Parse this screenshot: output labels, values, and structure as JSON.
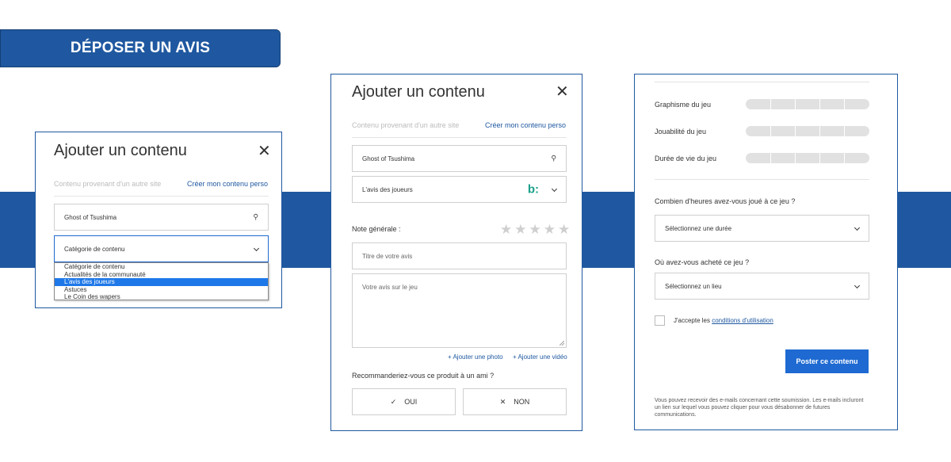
{
  "header": {
    "label": "DÉPOSER UN AVIS"
  },
  "panel1": {
    "title": "Ajouter un contenu",
    "close": "✕",
    "source_text": "Contenu provenant d'un autre site",
    "create_link": "Créer mon contenu perso",
    "search_value": "Ghost of Tsushima",
    "category_value": "Catégorie de contenu",
    "dropdown_options": [
      "Catégorie de contenu",
      "Actualités de la communauté",
      "L'avis des joueurs",
      "Astuces",
      "Le Coin des wapers"
    ],
    "selected_option": "L'avis des joueurs"
  },
  "panel2": {
    "title": "Ajouter un contenu",
    "close": "✕",
    "source_text": "Contenu provenant d'un autre site",
    "create_link": "Créer mon contenu perso",
    "search_value": "Ghost of Tsushima",
    "category_value": "L'avis des joueurs",
    "category_badge": "b:",
    "rating_label": "Note générale :",
    "rating_value": 0,
    "rating_max": 5,
    "title_placeholder": "Titre de votre avis",
    "review_placeholder": "Votre avis sur le jeu",
    "add_photo": "+ Ajouter une photo",
    "add_video": "+ Ajouter une vidéo",
    "recommend_question": "Recommanderiez-vous ce produit à un ami ?",
    "yes_icon": "✓",
    "yes_label": "OUI",
    "no_icon": "✕",
    "no_label": "NON",
    "colors": {
      "badge": "#1aa08a"
    }
  },
  "panel3": {
    "criteria": [
      {
        "label": "Graphisme du jeu"
      },
      {
        "label": "Jouabilité du jeu"
      },
      {
        "label": "Durée de vie du jeu"
      }
    ],
    "hours_question": "Combien d'heures avez-vous joué à ce jeu ?",
    "hours_value": "Sélectionnez une durée",
    "where_question": "Où avez-vous acheté ce jeu ?",
    "where_value": "Sélectionnez un lieu",
    "terms_prefix": "J'accepte les",
    "terms_link": "conditions d'utilisation",
    "post_button": "Poster ce contenu",
    "footer_text": "Vous pouvez recevoir des e-mails concernant cette soumission. Les e-mails incluront un lien sur lequel vous pouvez cliquer pour vous désabonner de futures communications."
  },
  "colors": {
    "brand_blue": "#1f58a0",
    "button_blue": "#1e6ad2",
    "selected_option": "#1e78e8"
  }
}
